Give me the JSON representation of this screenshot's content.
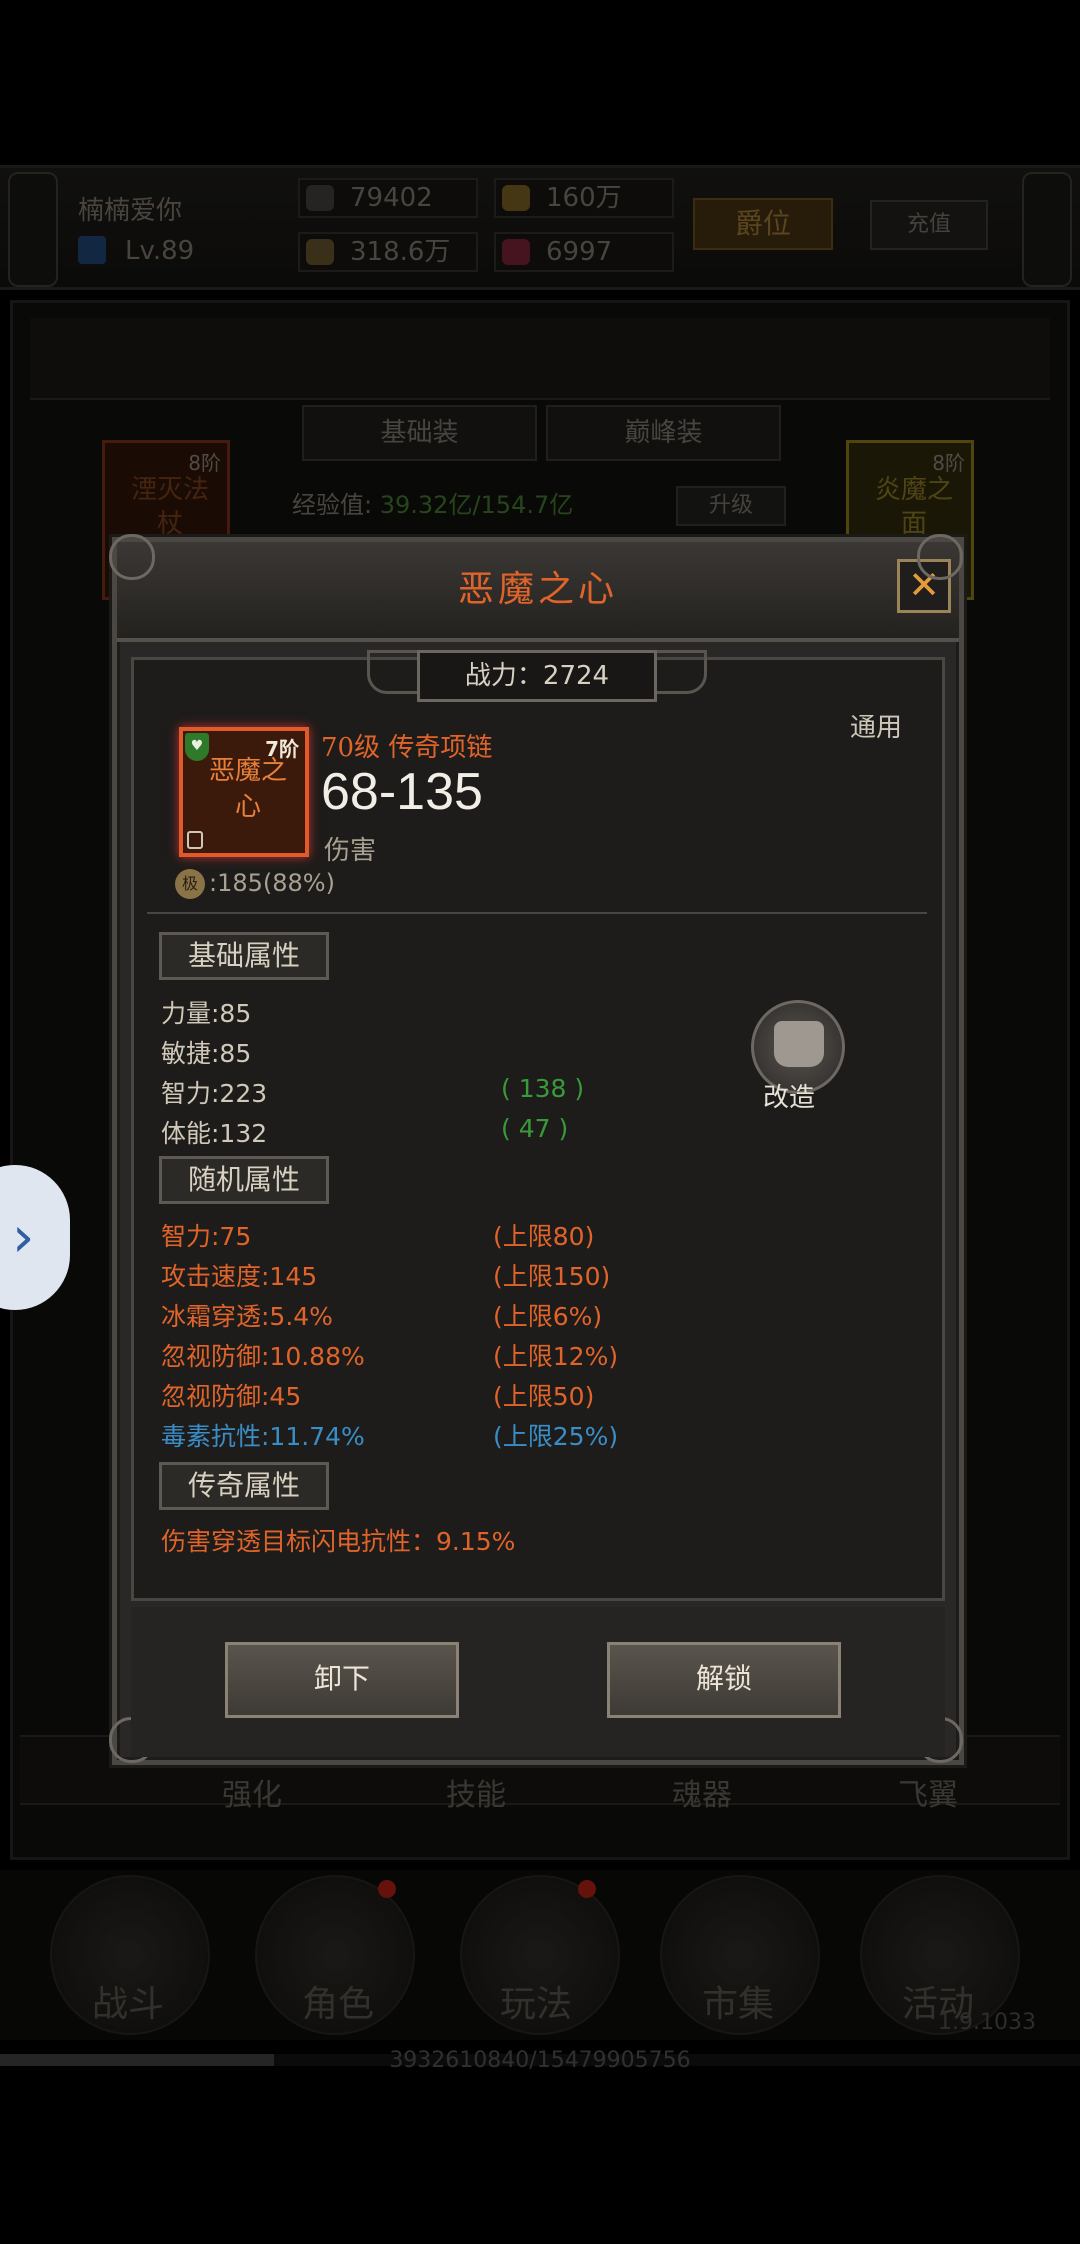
{
  "topbar": {
    "player_name": "楠楠爱你",
    "player_level": "Lv.89",
    "combat_power": "79402",
    "gold": "160万",
    "resource2": "318.6万",
    "gems": "6997",
    "rank_label": "爵位",
    "recharge_label": "充值"
  },
  "equip_tabs": [
    "基础装",
    "巅峰装"
  ],
  "exp": {
    "label": "经验值:",
    "value": "39.32亿/154.7亿",
    "upgrade_label": "升级"
  },
  "side_cards": [
    {
      "tier": "8阶",
      "name": "湮灭法杖"
    },
    {
      "tier": "8阶",
      "name": "炎魔之面"
    }
  ],
  "bottom_tabs": [
    "强化",
    "技能",
    "魂器",
    "飞翼"
  ],
  "nav": {
    "items": [
      "战斗",
      "角色",
      "玩法",
      "市集",
      "活动"
    ]
  },
  "version": "1.9.1033",
  "progress": {
    "text": "3932610840/15479905756",
    "fraction": 0.254
  },
  "modal": {
    "title": "恶魔之心",
    "close_glyph": "✕",
    "power": "战力：2724",
    "universal": "通用",
    "item": {
      "tier": "7阶",
      "name": "恶魔之心",
      "level_type": "70级 传奇项链",
      "damage": "68-135",
      "damage_label": "伤害",
      "durability_icon": "极",
      "durability": ":185(88%)"
    },
    "base_section": "基础属性",
    "base_attrs": [
      {
        "name": "力量:85",
        "add": ""
      },
      {
        "name": "敏捷:85",
        "add": ""
      },
      {
        "name": "智力:223",
        "add": "( 138 )"
      },
      {
        "name": "体能:132",
        "add": "( 47 )"
      }
    ],
    "reforge_label": "改造",
    "random_section": "随机属性",
    "random_attrs": [
      {
        "name": "智力:75",
        "cap": "(上限80)",
        "color": "orange"
      },
      {
        "name": "攻击速度:145",
        "cap": "(上限150)",
        "color": "orange"
      },
      {
        "name": "冰霜穿透:5.4%",
        "cap": "(上限6%)",
        "color": "orange"
      },
      {
        "name": "忽视防御:10.88%",
        "cap": "(上限12%)",
        "color": "orange"
      },
      {
        "name": "忽视防御:45",
        "cap": "(上限50)",
        "color": "orange"
      },
      {
        "name": "毒素抗性:11.74%",
        "cap": "(上限25%)",
        "color": "blue"
      }
    ],
    "legend_section": "传奇属性",
    "legend_attrs": [
      "伤害穿透目标闪电抗性：9.15%"
    ],
    "unequip_label": "卸下",
    "unlock_label": "解锁"
  },
  "colors": {
    "title_orange": "#e0642a",
    "add_green": "#3a9a3a",
    "stat_blue": "#3a8ec8"
  },
  "icons": {
    "side_arrow": "chevron-right-icon"
  }
}
